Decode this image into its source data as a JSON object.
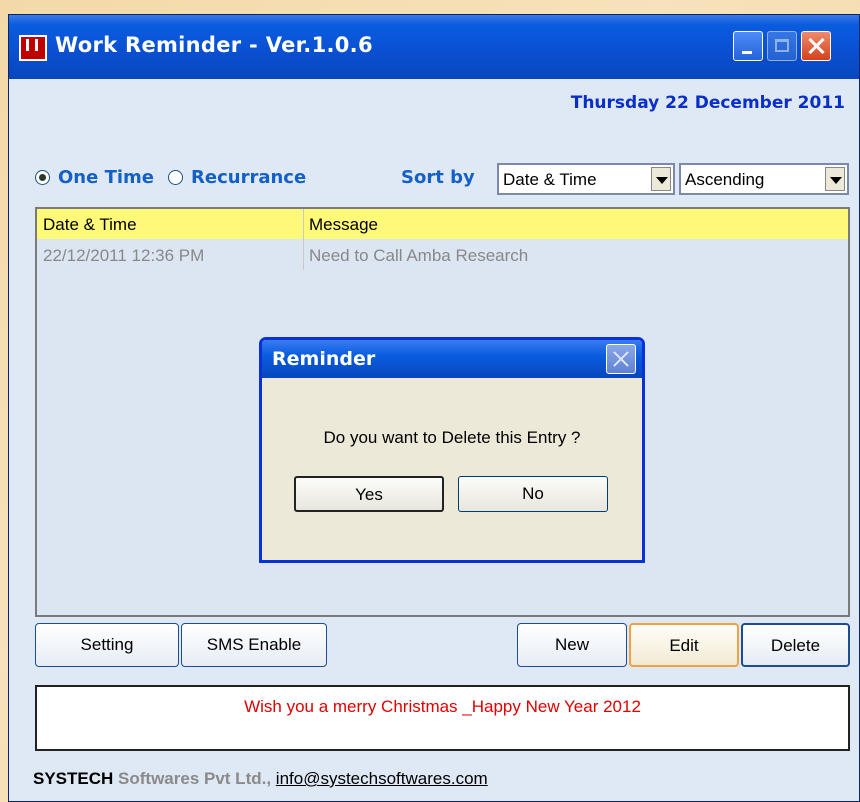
{
  "window": {
    "title": "Work Reminder - Ver.1.0.6"
  },
  "date_display": "Thursday 22 December 2011",
  "mode": {
    "options": [
      "One Time",
      "Recurrance"
    ],
    "selected": "One Time"
  },
  "sort": {
    "label": "Sort by",
    "field_value": "Date & Time",
    "order_value": "Ascending"
  },
  "list": {
    "columns": [
      "Date & Time",
      "Message"
    ],
    "rows": [
      {
        "datetime": "22/12/2011 12:36 PM",
        "message": "Need to Call Amba Research"
      }
    ]
  },
  "dialog": {
    "title": "Reminder",
    "message": "Do you want to Delete this Entry ?",
    "yes_label": "Yes",
    "no_label": "No"
  },
  "buttons": {
    "setting_label": "Setting",
    "sms_label": "SMS Enable",
    "new_label": "New",
    "edit_label": "Edit",
    "delete_label": "Delete"
  },
  "message_text": "Wish you a merry Christmas _Happy New Year 2012",
  "footer": {
    "company": "SYSTECH",
    "company_rest": "Softwares Pvt Ltd.,",
    "email": "info@systechsoftwares.com"
  },
  "colors": {
    "titlebar": "#0a4fd0",
    "accent_blue": "#1560c8",
    "header_yellow": "#fff97a",
    "message_red": "#e00000"
  }
}
